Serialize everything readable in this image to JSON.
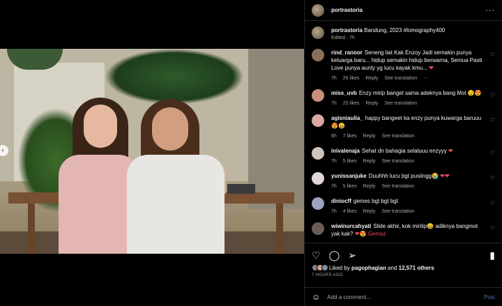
{
  "post": {
    "username": "portrastoria",
    "more": "···"
  },
  "caption": {
    "username": "portrastoria",
    "text": "Bandung, 2023 #lomography400",
    "meta": "Edited · 7h"
  },
  "comments": [
    {
      "user": "rind_ranoor",
      "text": "Seneng liat Kak Enzoy Jadi semakin punya keluarga baru... hidup semakin hidup berwarna, Semua Pasti Love punya aunty yg lucu kayak kmu...",
      "emoji": "❤",
      "time": "7h",
      "likes": "26 likes",
      "reply": "Reply",
      "extra": "See translation",
      "dots": "···",
      "avatar_color": "#8a6f5a"
    },
    {
      "user": "miss_uvb",
      "text": "Enzy mirip banget sama adeknya bang Mol",
      "emoji": "😯😍",
      "time": "7h",
      "likes": "25 likes",
      "reply": "Reply",
      "extra": "See translation",
      "avatar_color": "#c98f7a"
    },
    {
      "user": "agisniaulia_",
      "text": "happy bangeet ka enzy punya kuwarga baruuu",
      "emoji": "😍😄",
      "time": "6h",
      "likes": "7 likes",
      "reply": "Reply",
      "extra": "See translation",
      "avatar_color": "#d9a8a2"
    },
    {
      "user": "inivalenaja",
      "text": "Sehat dn bahagia selaluuu enzyyy",
      "emoji": "❤",
      "time": "7h",
      "likes": "5 likes",
      "reply": "Reply",
      "extra": "See translation",
      "avatar_color": "#cfc4bb"
    },
    {
      "user": "yunissanjuke",
      "text": "Duuhhh lucu bgt pusiingg😭",
      "emoji": "❤❤",
      "time": "7h",
      "likes": "5 likes",
      "reply": "Reply",
      "extra": "See translation",
      "avatar_color": "#e2d6d6"
    },
    {
      "user": "diniocff",
      "text": "gemes bgt bgt bgt",
      "emoji": "",
      "time": "7h",
      "likes": "4 likes",
      "reply": "Reply",
      "extra": "See translation",
      "avatar_color": "#9aa3c2"
    },
    {
      "user": "wiwinurcahyati",
      "text": "Slide akhir, kok miriiip😄 adiknya bangmol yak kak?",
      "emoji": "❤😍 Gemaz",
      "time": "",
      "likes": "",
      "reply": "",
      "extra": "",
      "avatar_color": "#6b5b55"
    }
  ],
  "likes": {
    "prefix": "Liked by",
    "user": "pagophagian",
    "and": "and",
    "count": "12,571 others"
  },
  "timestamp": "7 HOURS AGO",
  "comment_box": {
    "placeholder": "Add a comment...",
    "post_label": "Post"
  },
  "nav": {
    "prev": "‹"
  },
  "carousel": {
    "count": 6,
    "active_index": 2
  },
  "colors": {
    "background": "#000000",
    "muted": "#a8a8a8",
    "heart": "#ed4956",
    "post_link": "#5c6ba8"
  }
}
